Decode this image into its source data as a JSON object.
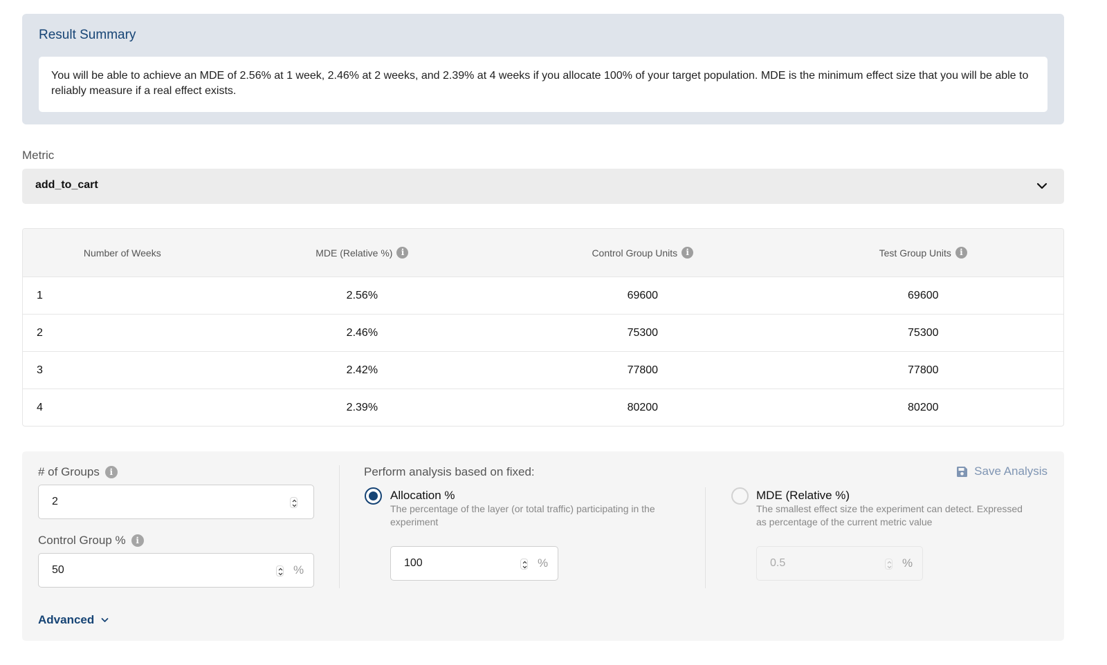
{
  "summary": {
    "title": "Result Summary",
    "text": "You will be able to achieve an MDE of 2.56% at 1 week, 2.46% at 2 weeks, and 2.39% at 4 weeks if you allocate 100% of your target population. MDE is the minimum effect size that you will be able to reliably measure if a real effect exists."
  },
  "metric": {
    "label": "Metric",
    "selected": "add_to_cart",
    "chevron_icon": "chevron-down-icon"
  },
  "table": {
    "headers": [
      "Number of Weeks",
      "MDE (Relative %)",
      "Control Group Units",
      "Test Group Units"
    ],
    "header_info_icons": [
      false,
      true,
      true,
      true
    ],
    "rows": [
      [
        "1",
        "2.56%",
        "69600",
        "69600"
      ],
      [
        "2",
        "2.46%",
        "75300",
        "75300"
      ],
      [
        "3",
        "2.42%",
        "77800",
        "77800"
      ],
      [
        "4",
        "2.39%",
        "80200",
        "80200"
      ]
    ]
  },
  "config": {
    "groups_label": "# of Groups",
    "groups_value": "2",
    "control_label": "Control Group %",
    "control_value": "50",
    "percent_symbol": "%",
    "fixed_heading": "Perform analysis based on fixed:",
    "save_label": "Save Analysis",
    "options": [
      {
        "title": "Allocation %",
        "description": "The percentage of the layer (or total traffic) participating in the experiment",
        "value": "100",
        "selected": true
      },
      {
        "title": "MDE (Relative %)",
        "description": "The smallest effect size the experiment can detect. Expressed as percentage of the current metric value",
        "value": "0.5",
        "selected": false
      }
    ],
    "advanced_label": "Advanced"
  },
  "colors": {
    "accent": "#164475",
    "summary_bg": "#dfe4eb",
    "save_link": "#7f95b3"
  }
}
